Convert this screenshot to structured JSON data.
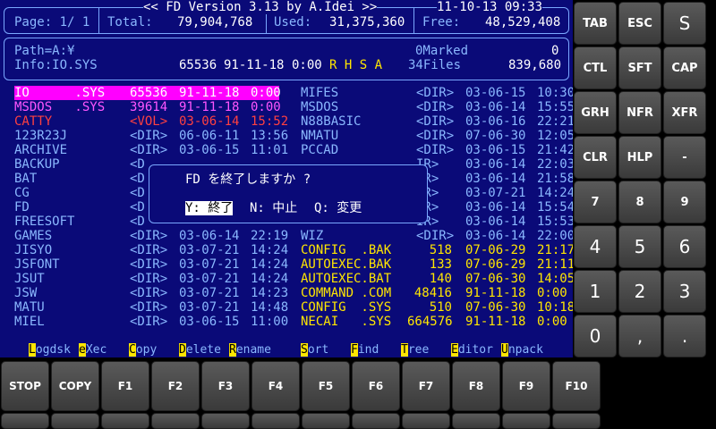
{
  "header": {
    "title": "<< FD Version 3.13 by A.Idei >>",
    "datetime": "11-10-13 09:33",
    "page": "Page: 1/ 1",
    "total_label": "Total:",
    "total_value": "79,904,768",
    "used_label": "Used:",
    "used_value": "31,375,360",
    "free_label": "Free:",
    "free_value": "48,529,408"
  },
  "info": {
    "path": "Path=A:¥",
    "marked": "0Marked",
    "marked_count": "0",
    "info_line": "Info:IO.SYS",
    "info_size": "65536",
    "info_date": "91-11-18",
    "info_time": "0:00",
    "info_attr": "R H S A",
    "files": "34Files",
    "files_size": "839,680"
  },
  "left_files": [
    {
      "name": "IO      .SYS",
      "size": "65536",
      "date": "91-11-18",
      "time": "0:00",
      "cls": "sel"
    },
    {
      "name": "MSDOS   .SYS",
      "size": "39614",
      "date": "91-11-18",
      "time": "0:00",
      "cls": "m"
    },
    {
      "name": "CATTY",
      "size": "<VOL>",
      "date": "03-06-14",
      "time": "15:52",
      "cls": "r"
    },
    {
      "name": "123R23J",
      "size": "<DIR>",
      "date": "06-06-11",
      "time": "13:56",
      "cls": ""
    },
    {
      "name": "ARCHIVE",
      "size": "<DIR>",
      "date": "03-06-15",
      "time": "11:01",
      "cls": ""
    },
    {
      "name": "BACKUP",
      "size": "<D",
      "date": "",
      "time": "",
      "cls": ""
    },
    {
      "name": "BAT",
      "size": "<D",
      "date": "",
      "time": "",
      "cls": ""
    },
    {
      "name": "CG",
      "size": "<D",
      "date": "",
      "time": "",
      "cls": ""
    },
    {
      "name": "FD",
      "size": "<D",
      "date": "",
      "time": "",
      "cls": ""
    },
    {
      "name": "FREESOFT",
      "size": "<D",
      "date": "",
      "time": "",
      "cls": ""
    },
    {
      "name": "GAMES",
      "size": "<DIR>",
      "date": "03-06-14",
      "time": "22:19",
      "cls": ""
    },
    {
      "name": "JISYO",
      "size": "<DIR>",
      "date": "03-07-21",
      "time": "14:24",
      "cls": ""
    },
    {
      "name": "JSFONT",
      "size": "<DIR>",
      "date": "03-07-21",
      "time": "14:24",
      "cls": ""
    },
    {
      "name": "JSUT",
      "size": "<DIR>",
      "date": "03-07-21",
      "time": "14:24",
      "cls": ""
    },
    {
      "name": "JSW",
      "size": "<DIR>",
      "date": "03-07-21",
      "time": "14:23",
      "cls": ""
    },
    {
      "name": "MATU",
      "size": "<DIR>",
      "date": "03-07-21",
      "time": "14:48",
      "cls": ""
    },
    {
      "name": "MIEL",
      "size": "<DIR>",
      "date": "03-06-15",
      "time": "11:00",
      "cls": ""
    }
  ],
  "right_files": [
    {
      "name": "MIFES",
      "size": "<DIR>",
      "date": "03-06-15",
      "time": "10:30",
      "cls": ""
    },
    {
      "name": "MSDOS",
      "size": "<DIR>",
      "date": "03-06-14",
      "time": "15:55",
      "cls": ""
    },
    {
      "name": "N88BASIC",
      "size": "<DIR>",
      "date": "03-06-16",
      "time": "22:21",
      "cls": ""
    },
    {
      "name": "NMATU",
      "size": "<DIR>",
      "date": "07-06-30",
      "time": "12:05",
      "cls": ""
    },
    {
      "name": "PCCAD",
      "size": "<DIR>",
      "date": "03-06-15",
      "time": "21:42",
      "cls": ""
    },
    {
      "name": "",
      "size": "IR>",
      "date": "03-06-14",
      "time": "22:03",
      "cls": ""
    },
    {
      "name": "",
      "size": "IR>",
      "date": "03-06-14",
      "time": "21:58",
      "cls": ""
    },
    {
      "name": "",
      "size": "IR>",
      "date": "03-07-21",
      "time": "14:24",
      "cls": ""
    },
    {
      "name": "",
      "size": "IR>",
      "date": "03-06-14",
      "time": "15:54",
      "cls": ""
    },
    {
      "name": "",
      "size": "IR>",
      "date": "03-06-14",
      "time": "15:53",
      "cls": ""
    },
    {
      "name": "WIZ",
      "size": "<DIR>",
      "date": "03-06-14",
      "time": "22:00",
      "cls": ""
    },
    {
      "name": "CONFIG  .BAK",
      "size": "518",
      "date": "07-06-29",
      "time": "21:17",
      "cls": "y"
    },
    {
      "name": "AUTOEXEC.BAK",
      "size": "133",
      "date": "07-06-29",
      "time": "21:11",
      "cls": "y"
    },
    {
      "name": "AUTOEXEC.BAT",
      "size": "140",
      "date": "07-06-30",
      "time": "14:05",
      "cls": "y"
    },
    {
      "name": "COMMAND .COM",
      "size": "48416",
      "date": "91-11-18",
      "time": "0:00",
      "cls": "y"
    },
    {
      "name": "CONFIG  .SYS",
      "size": "510",
      "date": "07-06-30",
      "time": "10:18",
      "cls": "y"
    },
    {
      "name": "NECAI   .SYS",
      "size": "664576",
      "date": "91-11-18",
      "time": "0:00",
      "cls": "y"
    }
  ],
  "dialog": {
    "message": "FD を終了しますか ?",
    "opt_yes": "Y: 終了",
    "opt_no": "N: 中止",
    "opt_change": "Q: 変更"
  },
  "funckeys": [
    {
      "hot": "L",
      "rest": "ogdsk"
    },
    {
      "hot": "e",
      "rest": "Xec"
    },
    {
      "hot": "C",
      "rest": "opy"
    },
    {
      "hot": "D",
      "rest": "elete"
    },
    {
      "hot": "R",
      "rest": "ename"
    },
    {
      "hot": "S",
      "rest": "ort"
    },
    {
      "hot": "F",
      "rest": "ind"
    },
    {
      "hot": "T",
      "rest": "ree"
    },
    {
      "hot": "E",
      "rest": "ditor"
    },
    {
      "hot": "U",
      "rest": "npack"
    }
  ],
  "side_keys": [
    "TAB",
    "ESC",
    "S",
    "CTL",
    "SFT",
    "CAP",
    "GRH",
    "NFR",
    "XFR",
    "CLR",
    "HLP",
    "-",
    "7",
    "8",
    "9",
    "4",
    "5",
    "6",
    "1",
    "2",
    "3",
    "0",
    ",",
    "."
  ],
  "bottom_keys": [
    "STOP",
    "COPY",
    "F1",
    "F2",
    "F3",
    "F4",
    "F5",
    "F6",
    "F7",
    "F8",
    "F9",
    "F10"
  ]
}
